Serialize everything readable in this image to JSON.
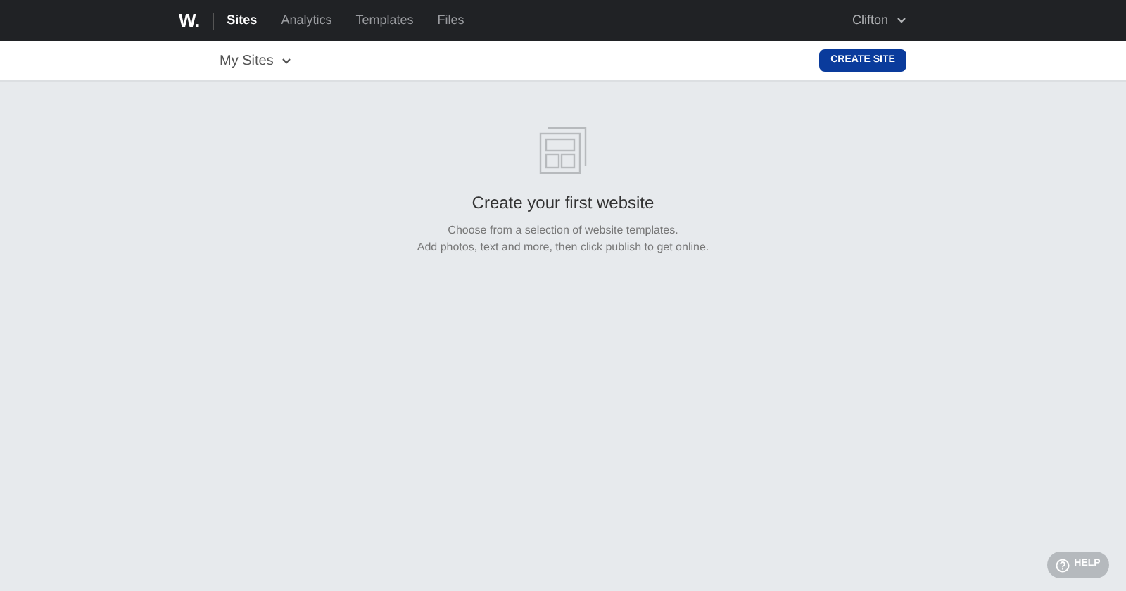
{
  "topbar": {
    "logo": "W.",
    "nav": [
      {
        "label": "Sites",
        "selected": true
      },
      {
        "label": "Analytics",
        "selected": false
      },
      {
        "label": "Templates",
        "selected": false
      },
      {
        "label": "Files",
        "selected": false
      }
    ],
    "user": "Clifton"
  },
  "subbar": {
    "title": "My Sites",
    "button": "CREATE SITE"
  },
  "empty_state": {
    "heading": "Create your first website",
    "lines": [
      "Choose from a selection of website templates.",
      "Add photos, text and more, then click publish to get online."
    ]
  },
  "help_button": "HELP"
}
